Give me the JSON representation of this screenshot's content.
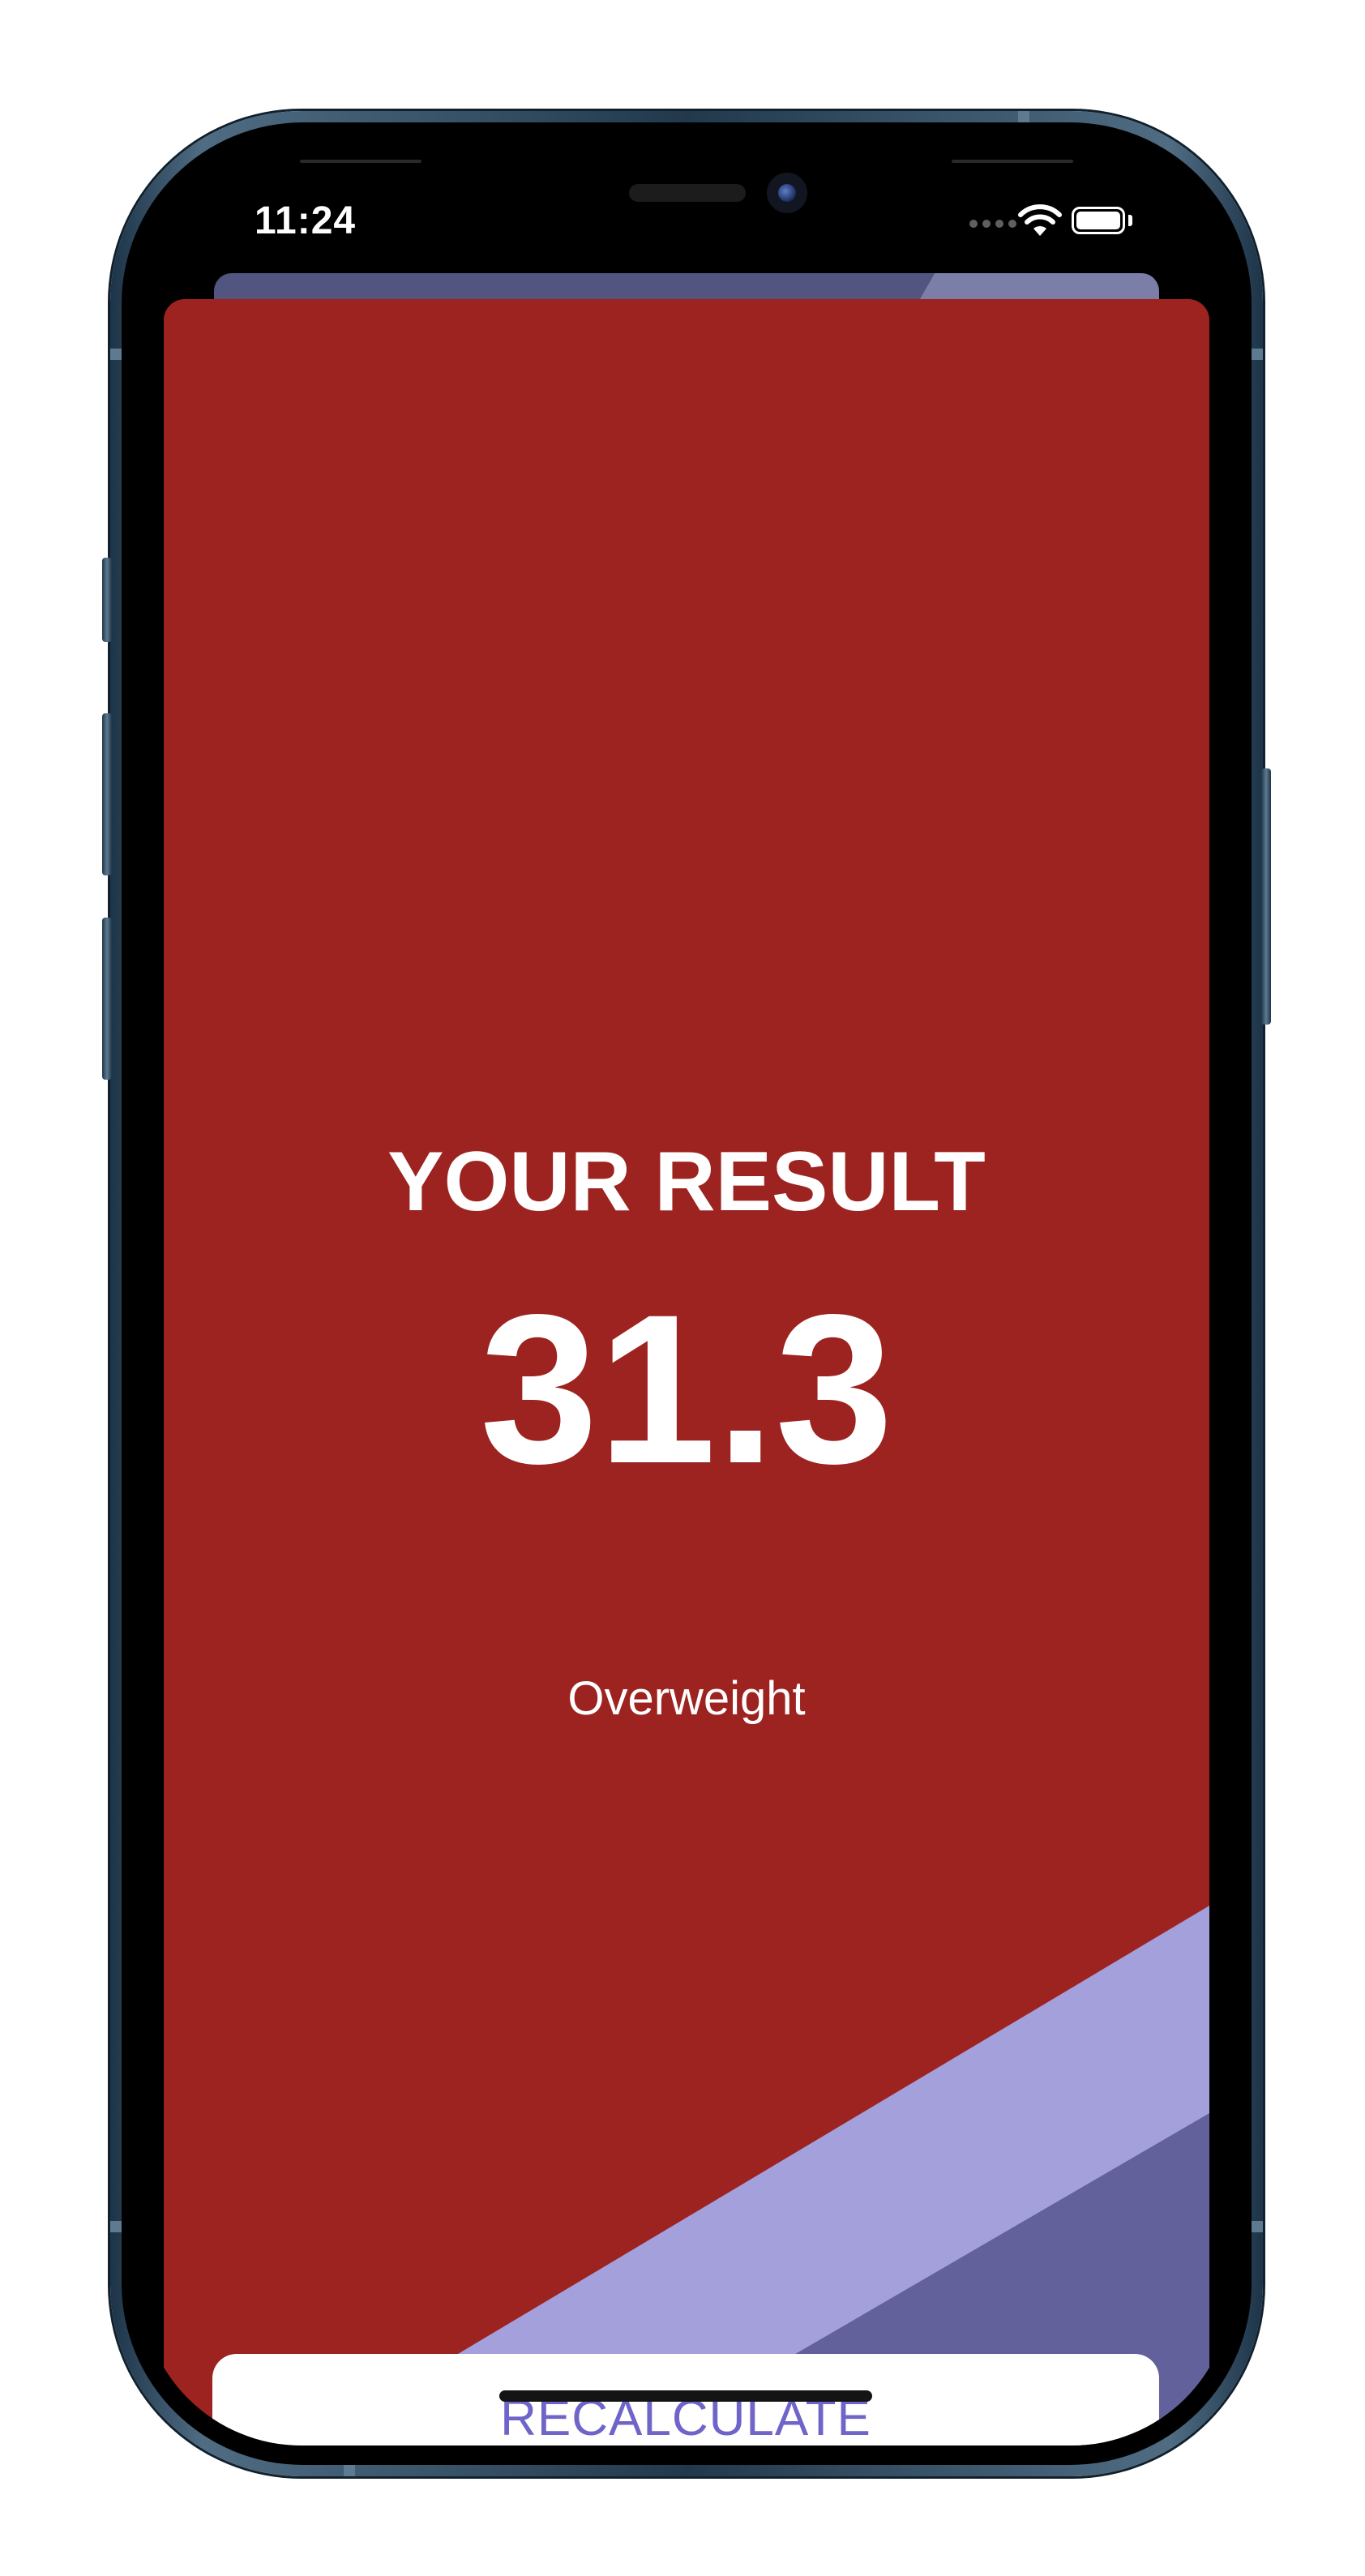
{
  "status_bar": {
    "time": "11:24",
    "icons": [
      "signal-dots-icon",
      "wifi-icon",
      "battery-icon"
    ]
  },
  "result": {
    "title": "YOUR RESULT",
    "value": "31.3",
    "category": "Overweight"
  },
  "actions": {
    "recalculate_label": "RECALCULATE"
  },
  "colors": {
    "card_background": "#9d2320",
    "stripe_light": "#a3a0dc",
    "stripe_dark": "#63619c",
    "button_text": "#6e64c9",
    "button_background": "#ffffff",
    "back_sheet": "#525580"
  }
}
